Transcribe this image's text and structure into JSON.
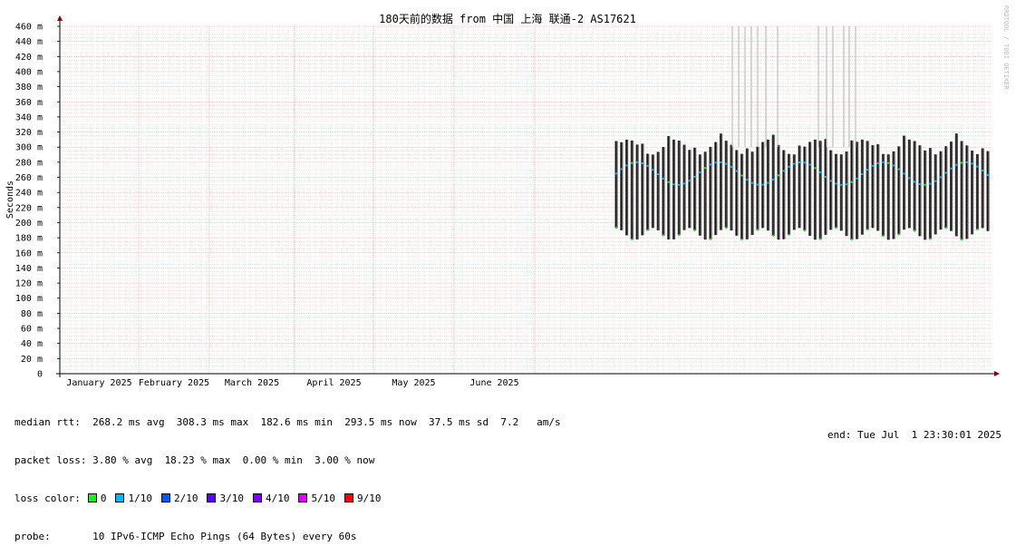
{
  "chart_data": {
    "type": "line",
    "title": "180天前的数据 from 中国 上海 联通-2 AS17621",
    "ylabel": "Seconds",
    "watermark": "RRDTOOL / TOBI OETIKER",
    "ylim": [
      0,
      460
    ],
    "y_ticks": [
      "0",
      "20 m",
      "40 m",
      "60 m",
      "80 m",
      "100 m",
      "120 m",
      "140 m",
      "160 m",
      "180 m",
      "200 m",
      "220 m",
      "240 m",
      "260 m",
      "280 m",
      "300 m",
      "320 m",
      "340 m",
      "360 m",
      "380 m",
      "400 m",
      "420 m",
      "440 m",
      "460 m"
    ],
    "x_ticks": [
      "January 2025",
      "February 2025",
      "March 2025",
      "April 2025",
      "May 2025",
      "June 2025"
    ],
    "series": [],
    "colors": {
      "background": "#ffffff",
      "grid": "#f2b3b3",
      "axis": "#000000",
      "arrow": "#8b0000"
    }
  },
  "stats": {
    "median_rtt": "median rtt:  268.2 ms avg  308.3 ms max  182.6 ms min  293.5 ms now  37.5 ms sd  7.2   am/s",
    "packet_loss": "packet loss: 3.80 % avg  18.23 % max  0.00 % min  3.00 % now",
    "loss_color_label": "loss color:",
    "loss_colors": [
      {
        "label": "0",
        "color": "#26e826"
      },
      {
        "label": "1/10",
        "color": "#00b8ff"
      },
      {
        "label": "2/10",
        "color": "#0059ff"
      },
      {
        "label": "3/10",
        "color": "#5e00ff"
      },
      {
        "label": "4/10",
        "color": "#7e00ff"
      },
      {
        "label": "5/10",
        "color": "#dd00ff"
      },
      {
        "label": "9/10",
        "color": "#ff0000"
      }
    ],
    "probe": "probe:       10 IPv6-ICMP Echo Pings (64 Bytes) every 60s",
    "end": "end: Tue Jul  1 23:30:01 2025"
  }
}
